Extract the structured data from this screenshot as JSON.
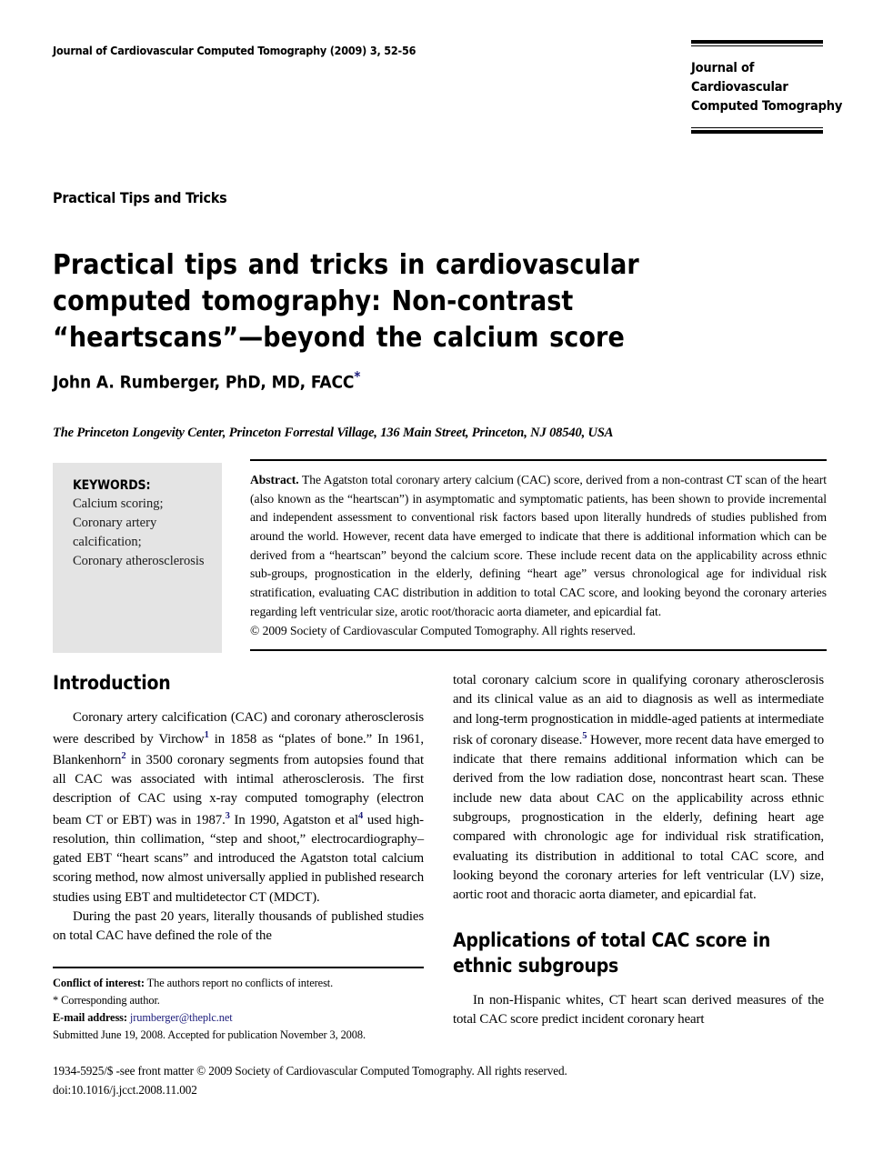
{
  "running_head": "Journal of Cardiovascular Computed Tomography (2009) 3, 52-56",
  "logo": {
    "line1": "Journal of",
    "line2": "Cardiovascular",
    "line3": "Computed Tomography"
  },
  "kicker": "Practical Tips and Tricks",
  "title": "Practical tips and tricks in cardiovascular computed tomography: Non-contrast “heartscans”—beyond the calcium score",
  "author": {
    "name": "John A. Rumberger, PhD, MD, FACC",
    "corresponding_marker": "*"
  },
  "affiliation": "The Princeton Longevity Center, Princeton Forrestal Village, 136 Main Street, Princeton, NJ 08540, USA",
  "keywords": {
    "heading": "KEYWORDS:",
    "items": [
      "Calcium scoring;",
      "Coronary artery",
      "calcification;",
      "Coronary atherosclerosis"
    ]
  },
  "abstract": {
    "label": "Abstract",
    "text": "The Agatston total coronary artery calcium (CAC) score, derived from a non-contrast CT scan of the heart (also known as the “heartscan”) in asymptomatic and symptomatic patients, has been shown to provide incremental and independent assessment to conventional risk factors based upon literally hundreds of studies published from around the world. However, recent data have emerged to indicate that there is additional information which can be derived from a “heartscan” beyond the calcium score. These include recent data on the applicability across ethnic sub-groups, prognostication in the elderly, defining “heart age” versus chronological age for individual risk stratification, evaluating CAC distribution in addition to total CAC score, and looking beyond the coronary arteries regarding left ventricular size, arotic root/thoracic aorta diameter, and epicardial fat.",
    "copyright": "© 2009 Society of Cardiovascular Computed Tomography. All rights reserved."
  },
  "left_column": {
    "heading": "Introduction",
    "para1_a": "Coronary artery calcification (CAC) and coronary atherosclerosis were described by Virchow",
    "para1_ref1": "1",
    "para1_b": " in 1858 as “plates of bone.” In 1961, Blankenhorn",
    "para1_ref2": "2",
    "para1_c": " in 3500 coronary segments from autopsies found that all CAC was associated with intimal atherosclerosis. The first description of CAC using x-ray computed tomography (electron beam CT or EBT) was in 1987.",
    "para1_ref3": "3",
    "para1_d": " In 1990, Agatston et al",
    "para1_ref4": "4",
    "para1_e": " used high-resolution, thin collimation, “step and shoot,” electrocardiography–gated EBT “heart scans” and introduced the Agatston total calcium scoring method, now almost universally applied in published research studies using EBT and multidetector CT (MDCT).",
    "para2": "During the past 20 years, literally thousands of published studies on total CAC have defined the role of the"
  },
  "right_column": {
    "para1_a": "total coronary calcium score in qualifying coronary atherosclerosis and its clinical value as an aid to diagnosis as well as intermediate and long-term prognostication in middle-aged patients at intermediate risk of coronary disease.",
    "para1_ref5": "5",
    "para1_b": " However, more recent data have emerged to indicate that there remains additional information which can be derived from the low radiation dose, noncontrast heart scan. These include new data about CAC on the applicability across ethnic subgroups, prognostication in the elderly, defining heart age compared with chronologic age for individual risk stratification, evaluating its distribution in additional to total CAC score, and looking beyond the coronary arteries for left ventricular (LV) size, aortic root and thoracic aorta diameter, and epicardial fat.",
    "heading": "Applications of total CAC score in ethnic subgroups",
    "para2": "In non-Hispanic whites, CT heart scan derived measures of the total CAC score predict incident coronary heart"
  },
  "footnotes": {
    "conflict_label": "Conflict of interest:",
    "conflict_text": " The authors report no conflicts of interest.",
    "corresponding": "* Corresponding author.",
    "email_label": "E-mail address:",
    "email_value": " jrumberger@theplc.net",
    "dates": "Submitted June 19, 2008. Accepted for publication November 3, 2008."
  },
  "bottom_matter": {
    "line1": "1934-5925/$ -see front matter © 2009 Society of Cardiovascular Computed Tomography. All rights reserved.",
    "line2": "doi:10.1016/j.jcct.2008.11.002"
  },
  "colors": {
    "link": "#1b1b7a",
    "keyword_panel": "#e4e4e4",
    "text": "#000000"
  }
}
